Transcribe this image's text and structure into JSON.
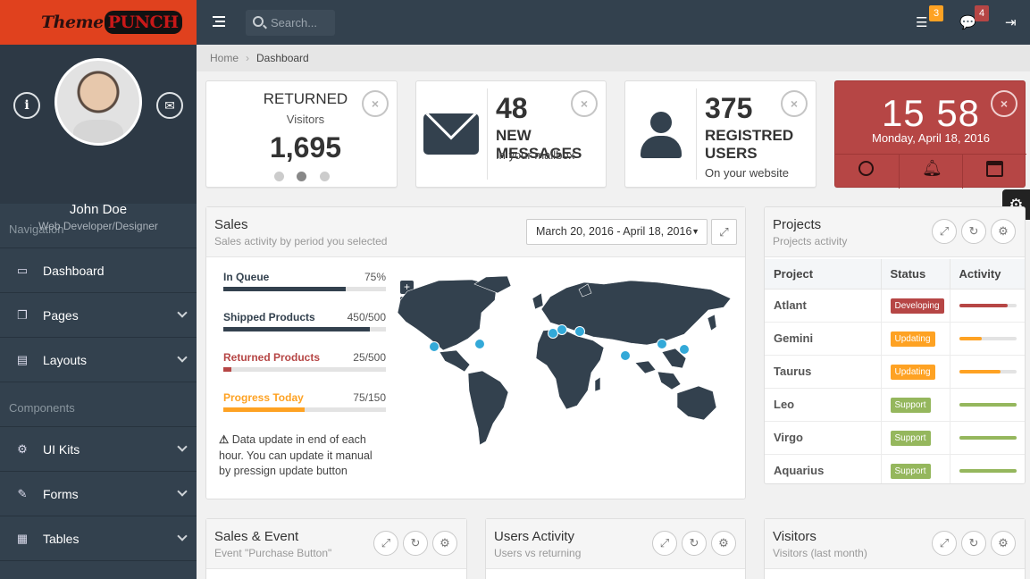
{
  "brand": {
    "logo_word1": "Theme",
    "logo_word2": "PUNCH"
  },
  "profile": {
    "name": "John Doe",
    "role": "Web Developer/Designer"
  },
  "nav": {
    "section1": "Navigation",
    "section2": "Components",
    "items": [
      {
        "label": "Dashboard",
        "icon": "desktop-icon"
      },
      {
        "label": "Pages",
        "icon": "pages-icon"
      },
      {
        "label": "Layouts",
        "icon": "file-icon"
      },
      {
        "label": "UI Kits",
        "icon": "cogs-icon"
      },
      {
        "label": "Forms",
        "icon": "pencil-icon"
      },
      {
        "label": "Tables",
        "icon": "table-icon"
      }
    ]
  },
  "topbar": {
    "search_placeholder": "Search...",
    "tasks_badge": "3",
    "messages_badge": "4"
  },
  "breadcrumb": {
    "home": "Home",
    "current": "Dashboard"
  },
  "tiles": {
    "returned": {
      "title": "RETURNED",
      "subtitle": "Visitors",
      "value": "1,695"
    },
    "messages": {
      "value": "48",
      "title": "NEW MESSAGES",
      "subtitle": "In your mailbox"
    },
    "users": {
      "value": "375",
      "title1": "REGISTRED",
      "title2": "USERS",
      "subtitle": "On your website"
    },
    "clock": {
      "hour": "15",
      "minute": "58",
      "date": "Monday, April 18, 2016"
    }
  },
  "sales": {
    "title": "Sales",
    "subtitle": "Sales activity by period you selected",
    "daterange": "March 20, 2016 - April 18, 2016",
    "bars": [
      {
        "label": "In Queue",
        "value": "75%",
        "pct": 75,
        "color": "#33414e"
      },
      {
        "label": "Shipped Products",
        "value": "450/500",
        "pct": 90,
        "color": "#33414e"
      },
      {
        "label": "Returned Products",
        "value": "25/500",
        "pct": 5,
        "color": "#b64645"
      },
      {
        "label": "Progress Today",
        "value": "75/150",
        "pct": 50,
        "color": "#fea223"
      }
    ],
    "note": "Data update in end of each hour. You can update it manual by pressign update button",
    "zoom_in": "+",
    "zoom_out": "−"
  },
  "projects": {
    "title": "Projects",
    "subtitle": "Projects activity",
    "columns": [
      "Project",
      "Status",
      "Activity"
    ],
    "rows": [
      {
        "name": "Atlant",
        "status": "Developing",
        "color": "#b64645",
        "activity": 85
      },
      {
        "name": "Gemini",
        "status": "Updating",
        "color": "#fea223",
        "activity": 40
      },
      {
        "name": "Taurus",
        "status": "Updating",
        "color": "#fea223",
        "activity": 72
      },
      {
        "name": "Leo",
        "status": "Support",
        "color": "#95b75d",
        "activity": 100
      },
      {
        "name": "Virgo",
        "status": "Support",
        "color": "#95b75d",
        "activity": 100
      },
      {
        "name": "Aquarius",
        "status": "Support",
        "color": "#95b75d",
        "activity": 100
      }
    ]
  },
  "bottom": {
    "p1": {
      "title": "Sales & Event",
      "subtitle": "Event \"Purchase Button\""
    },
    "p2": {
      "title": "Users Activity",
      "subtitle": "Users vs returning"
    },
    "p3": {
      "title": "Visitors",
      "subtitle": "Visitors (last month)"
    }
  }
}
